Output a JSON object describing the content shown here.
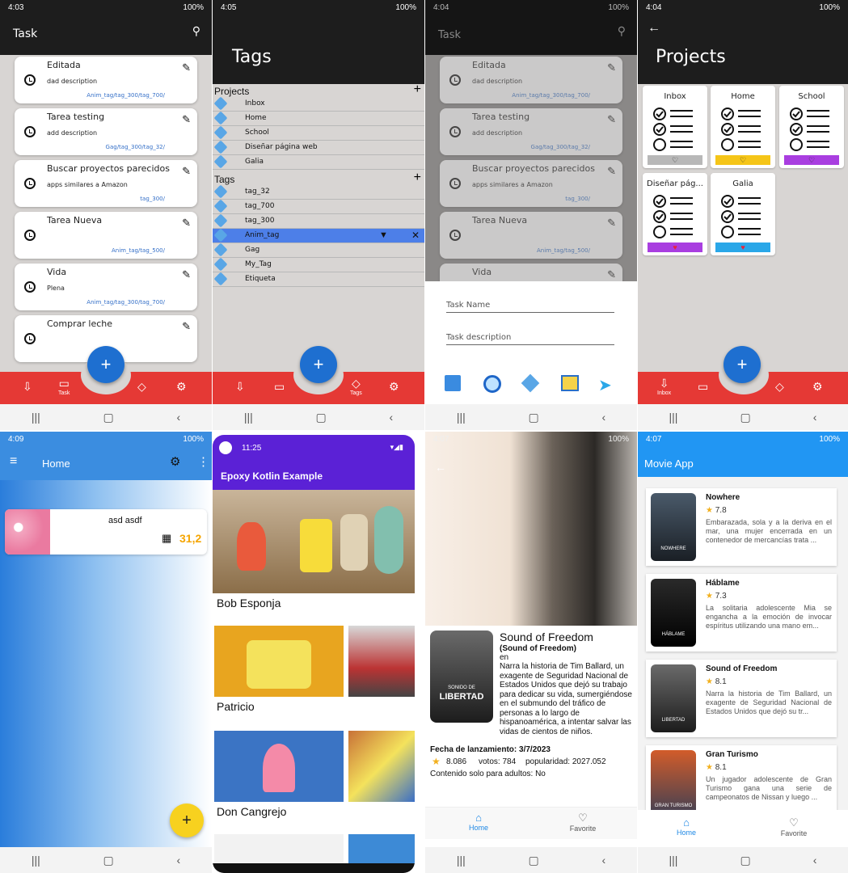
{
  "s1": {
    "time": "4:03",
    "status": "100%",
    "title": "Task",
    "tasks": [
      {
        "title": "Editada",
        "desc": "dad description",
        "tags": "Anim_tag/tag_300/tag_700/"
      },
      {
        "title": "Tarea testing",
        "desc": "add description",
        "tags": "Gag/tag_300/tag_32/"
      },
      {
        "title": "Buscar proyectos parecidos",
        "desc": "apps similares a Amazon",
        "tags": "tag_300/"
      },
      {
        "title": "Tarea Nueva",
        "desc": "",
        "tags": "Anim_tag/tag_500/"
      },
      {
        "title": "Vida",
        "desc": "Plena",
        "tags": "Anim_tag/tag_300/tag_700/"
      },
      {
        "title": "Comprar leche",
        "desc": "",
        "tags": ""
      }
    ],
    "fab": "+",
    "bottom_label": "Task"
  },
  "s2": {
    "time": "4:05",
    "status": "100%",
    "title": "Tags",
    "projects_header": "Projects",
    "tags_header": "Tags",
    "projects": [
      "Inbox",
      "Home",
      "School",
      "Diseñar página web",
      "Galia"
    ],
    "tags": [
      "tag_32",
      "tag_700",
      "tag_300",
      "Anim_tag",
      "Gag",
      "My_Tag",
      "Etiqueta"
    ],
    "fab": "+",
    "bottom_label": "Tags"
  },
  "s3": {
    "time": "4:04",
    "status": "100%",
    "title": "Task",
    "tasks": [
      {
        "title": "Editada",
        "desc": "dad description",
        "tags": "Anim_tag/tag_300/tag_700/"
      },
      {
        "title": "Tarea testing",
        "desc": "add description",
        "tags": "Gag/tag_300/tag_32/"
      },
      {
        "title": "Buscar proyectos parecidos",
        "desc": "apps similares a Amazon",
        "tags": "tag_300/"
      },
      {
        "title": "Tarea Nueva",
        "desc": "",
        "tags": "Anim_tag/tag_500/"
      },
      {
        "title": "Vida",
        "desc": "",
        "tags": ""
      }
    ],
    "name_placeholder": "Task Name",
    "desc_placeholder": "Task description"
  },
  "s4": {
    "time": "4:04",
    "status": "100%",
    "title": "Projects",
    "projects": [
      {
        "name": "Inbox",
        "color": "#b8b8b8",
        "heart": "♡"
      },
      {
        "name": "Home",
        "color": "#f5c518",
        "heart": "♡"
      },
      {
        "name": "School",
        "color": "#a93ee0",
        "heart": "♡"
      },
      {
        "name": "Diseñar pág...",
        "color": "#a93ee0",
        "heart": "♥"
      },
      {
        "name": "Galia",
        "color": "#2aa7e8",
        "heart": "♥"
      }
    ],
    "fab": "+",
    "bottom_label": "Inbox"
  },
  "s5": {
    "time": "4:09",
    "status": "100%",
    "title": "Home",
    "card_title": "asd asdf",
    "card_num": "31,2",
    "fab": "+"
  },
  "s6": {
    "time": "11:25",
    "title": "Epoxy Kotlin Example",
    "items": [
      "Bob Esponja",
      "Patricio",
      "Don Cangrejo"
    ]
  },
  "s7": {
    "time": "4:07",
    "status": "100%",
    "title": "Sound of Freedom",
    "original": "(Sound of Freedom)",
    "lang": "en",
    "overview": "Narra la historia de Tim Ballard, un exagente de Seguridad Nacional de Estados Unidos que dejó su trabajo para dedicar su vida, sumergiéndose en el submundo del tráfico de personas a lo largo de hispanoamérica, a intentar salvar las vidas de cientos de niños.",
    "release": "Fecha de lanzamiento: 3/7/2023",
    "rating": "8.086",
    "votes": "votos: 784",
    "popularity": "popularidad: 2027.052",
    "adult": "Contenido solo para adultos: No",
    "poster_text": "LIBERTAD",
    "poster_small": "SONIDO DE",
    "nav_home": "Home",
    "nav_fav": "Favorite"
  },
  "s8": {
    "time": "4:07",
    "status": "100%",
    "title": "Movie App",
    "movies": [
      {
        "title": "Nowhere",
        "rating": "7.8",
        "overview": "Embarazada, sola y a la deriva en el mar, una mujer encerrada en un contenedor de mercancías trata ...",
        "poster": "NOWHERE"
      },
      {
        "title": "Háblame",
        "rating": "7.3",
        "overview": "La solitaria adolescente Mia se engancha a la emoción de invocar espíritus utilizando una mano em...",
        "poster": "HÁBLAME"
      },
      {
        "title": "Sound of Freedom",
        "rating": "8.1",
        "overview": "Narra la historia de Tim Ballard, un exagente de Seguridad Nacional de Estados Unidos que dejó su tr...",
        "poster": "LIBERTAD"
      },
      {
        "title": "Gran Turismo",
        "rating": "8.1",
        "overview": "Un jugador adolescente de Gran Turismo gana una serie de campeonatos de Nissan y luego ...",
        "poster": "GRAN TURISMO"
      }
    ],
    "nav_home": "Home",
    "nav_fav": "Favorite"
  }
}
